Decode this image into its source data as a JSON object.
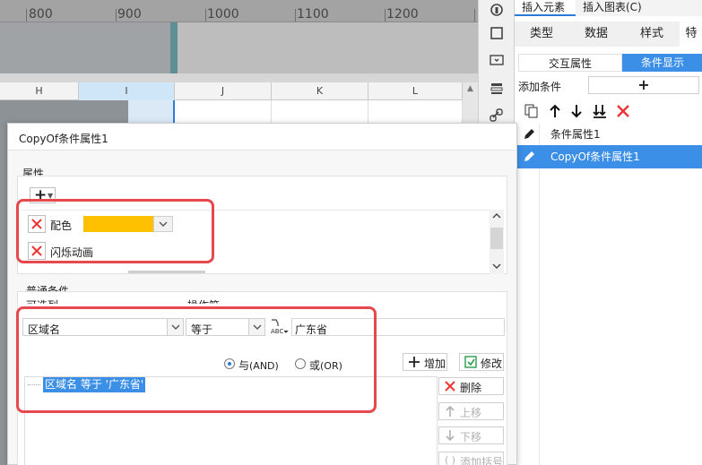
{
  "ruler": {
    "labels": [
      "800",
      "900",
      "1000",
      "1100",
      "1200"
    ]
  },
  "columns": [
    "H",
    "I",
    "J",
    "K",
    "L"
  ],
  "right_panel": {
    "top_tabs": [
      "插入元素",
      "插入图表(C)"
    ],
    "sub_tabs": [
      "类型",
      "数据",
      "样式",
      "特"
    ],
    "segment": {
      "left": "交互属性",
      "right": "条件显示"
    },
    "add_condition_label": "添加条件",
    "add_condition_button": "+",
    "items": [
      "条件属性1",
      "CopyOf条件属性1"
    ]
  },
  "dialog": {
    "title": "CopyOf条件属性1",
    "attributes_label": "属性",
    "properties": [
      {
        "name": "配色",
        "color": "#ffc000"
      },
      {
        "name": "闪烁动画"
      }
    ],
    "normal_conditions_label": "普通条件",
    "column_field_label": "可选列",
    "operator_label": "操作符",
    "column_value": "区域名",
    "operator_value": "等于",
    "value": "广东省",
    "and_label": "与",
    "and_suffix": "(AND)",
    "or_label": "或",
    "or_suffix": "(OR)",
    "buttons": {
      "add": "增加",
      "modify": "修改",
      "delete": "删除",
      "move_up": "上移",
      "move_down": "下移",
      "add_bracket": "添加括号"
    },
    "condition_item": "区域名 等于 '广东省'"
  },
  "colors": {
    "accent": "#3b8fe6",
    "highlight": "#e5484d",
    "swatch": "#ffc000"
  }
}
